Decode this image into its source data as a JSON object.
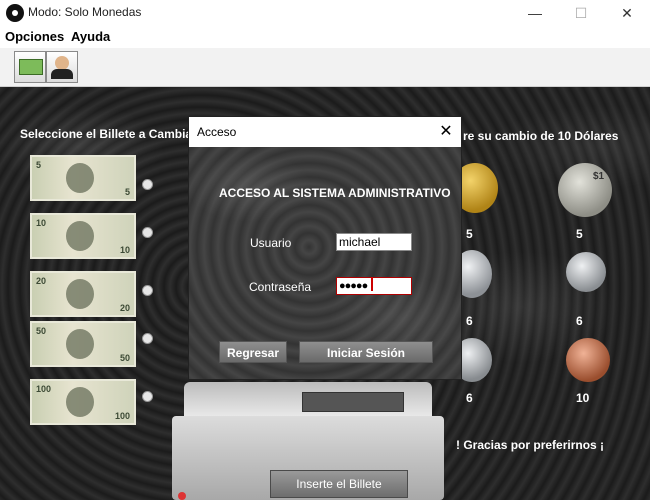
{
  "window": {
    "title": "Modo: Solo Monedas",
    "minimize_glyph": "—",
    "maximize_glyph": "☐",
    "close_glyph": "✕"
  },
  "menu": {
    "items": [
      {
        "label": "Opciones"
      },
      {
        "label": "Ayuda"
      }
    ]
  },
  "toolbar": {
    "buttons": [
      {
        "icon": "money-icon"
      },
      {
        "icon": "user-admin-icon"
      }
    ]
  },
  "main": {
    "left_heading": "Seleccione el Billete a Cambia",
    "right_heading": "re su cambio de 10 Dólares",
    "bills": [
      {
        "denomination": "5"
      },
      {
        "denomination": "10"
      },
      {
        "denomination": "20"
      },
      {
        "denomination": "50"
      },
      {
        "denomination": "100"
      }
    ],
    "coins": [
      {
        "label": "5",
        "color": "#c8a032"
      },
      {
        "label": "5",
        "color": "#a8a8a0"
      },
      {
        "label": "6",
        "color": "#c0c4c8"
      },
      {
        "label": "6",
        "color": "#b8bcc0"
      },
      {
        "label": "6",
        "color": "#b4b8bc"
      },
      {
        "label": "10",
        "color": "#c77a55"
      }
    ],
    "coin_symbol": "$1",
    "footer_text": "! Gracias por preferirnos ¡",
    "machine_button": "Inserte el Billete"
  },
  "dialog": {
    "title": "Acceso",
    "close_glyph": "✕",
    "heading": "ACCESO AL SISTEMA ADMINISTRATIVO",
    "username_label": "Usuario",
    "username_value": "michael",
    "password_label": "Contraseña",
    "password_value": "●●●●●",
    "back_button": "Regresar",
    "login_button": "Iniciar Sesión"
  }
}
